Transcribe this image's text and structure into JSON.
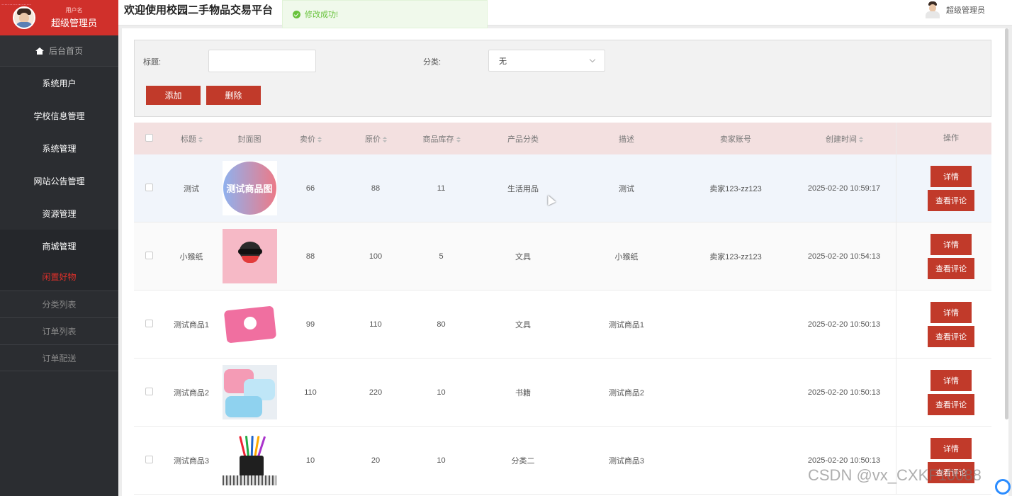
{
  "sidebar": {
    "topline": "...................",
    "user_label": "用户名",
    "user_role": "超级管理员",
    "home": "后台首页",
    "items": [
      {
        "label": "系统用户"
      },
      {
        "label": "学校信息管理"
      },
      {
        "label": "系统管理"
      },
      {
        "label": "网站公告管理"
      },
      {
        "label": "资源管理"
      }
    ],
    "group": "商城管理",
    "active_item": "闲置好物",
    "sub_items": [
      {
        "label": "分类列表"
      },
      {
        "label": "订单列表"
      },
      {
        "label": "订单配送"
      }
    ]
  },
  "header": {
    "welcome": "欢迎使用校园二手物品交易平台",
    "toast": "修改成功!",
    "user_role": "超级管理员"
  },
  "filter": {
    "title_label": "标题:",
    "title_value": "",
    "category_label": "分类:",
    "category_value": "无",
    "add_label": "添加",
    "delete_label": "删除"
  },
  "table": {
    "headers": {
      "title": "标题",
      "cover": "封面图",
      "price": "卖价",
      "original_price": "原价",
      "stock": "商品库存",
      "category": "产品分类",
      "description": "描述",
      "seller": "卖家账号",
      "created": "创建时间",
      "actions": "操作"
    },
    "rows": [
      {
        "title": "测试",
        "cover_text": "测试商品图",
        "price": "66",
        "original_price": "88",
        "stock": "11",
        "category": "生活用品",
        "description": "测试",
        "seller": "卖家123-zz123",
        "created": "2025-02-20 10:59:17"
      },
      {
        "title": "小猴纸",
        "price": "88",
        "original_price": "100",
        "stock": "5",
        "category": "文具",
        "description": "小猴纸",
        "seller": "卖家123-zz123",
        "created": "2025-02-20 10:54:13"
      },
      {
        "title": "测试商品1",
        "price": "99",
        "original_price": "110",
        "stock": "80",
        "category": "文具",
        "description": "测试商品1",
        "seller": "",
        "created": "2025-02-20 10:50:13"
      },
      {
        "title": "测试商品2",
        "price": "110",
        "original_price": "220",
        "stock": "10",
        "category": "书籍",
        "description": "测试商品2",
        "seller": "",
        "created": "2025-02-20 10:50:13"
      },
      {
        "title": "测试商品3",
        "price": "10",
        "original_price": "20",
        "stock": "10",
        "category": "分类二",
        "description": "测试商品3",
        "seller": "",
        "created": "2025-02-20 10:50:13"
      }
    ],
    "detail_label": "详情",
    "comments_label": "查看评论"
  },
  "watermark": "CSDN @vx_CXKF10088",
  "colors": {
    "brand_red": "#d0302b",
    "button_red": "#c13a2a",
    "sidebar_bg": "#2b2d31",
    "success_green": "#67c23a"
  }
}
